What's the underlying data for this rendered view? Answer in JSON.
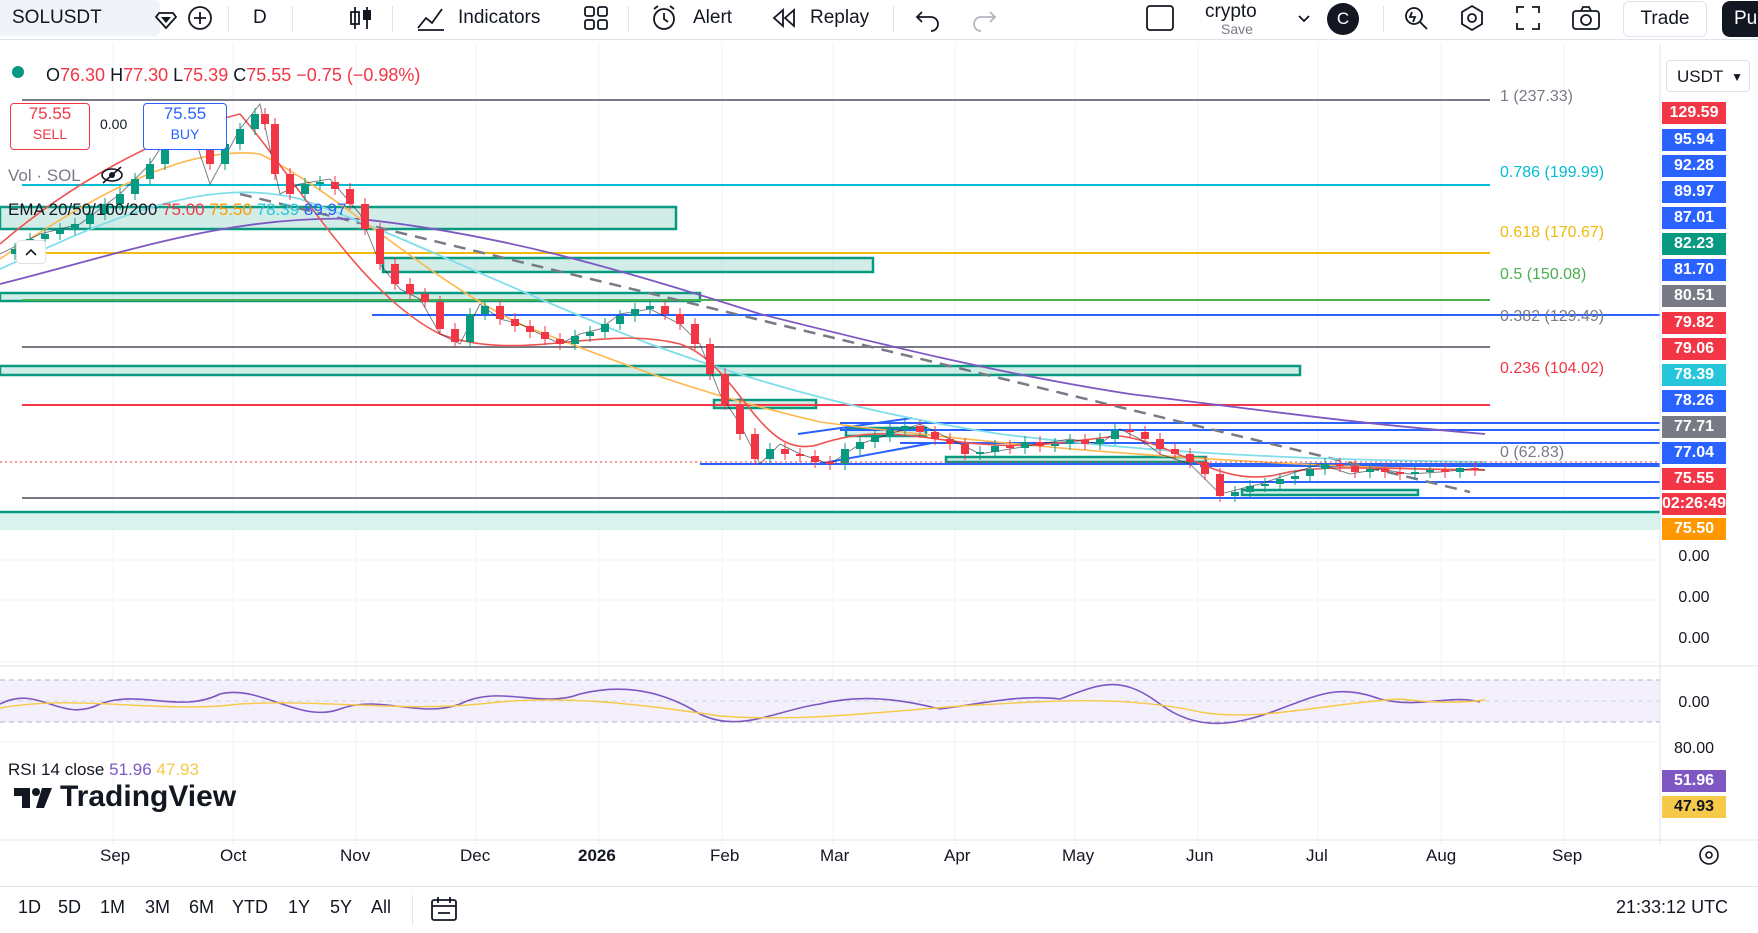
{
  "toolbar": {
    "symbol": "SOLUSDT",
    "interval": "D",
    "indicators_label": "Indicators",
    "alert_label": "Alert",
    "replay_label": "Replay",
    "layout_name": "crypto",
    "layout_sub": "Save",
    "avatar_letter": "C",
    "trade_label": "Trade",
    "publish_label": "Pu"
  },
  "legend": {
    "ohlc_o_label": "O",
    "ohlc_o": "76.30",
    "ohlc_h_label": "H",
    "ohlc_h": "77.30",
    "ohlc_l_label": "L",
    "ohlc_l": "75.39",
    "ohlc_c_label": "C",
    "ohlc_c": "75.55",
    "change": "−0.75 (−0.98%)",
    "sell_price": "75.55",
    "sell_label": "SELL",
    "spread": "0.00",
    "buy_price": "75.55",
    "buy_label": "BUY",
    "vol_label": "Vol · SOL",
    "ema_label": "EMA 20/50/100/200",
    "ema20": "75.00",
    "ema50": "75.50",
    "ema100": "78.39",
    "ema200": "89.97",
    "rsi_label": "RSI 14 close",
    "rsi_value": "51.96",
    "rsi_ma": "47.93"
  },
  "fib_levels": [
    {
      "label": "1 (237.33)",
      "color": "#787b86"
    },
    {
      "label": "0.786 (199.99)",
      "color": "#00bcd4"
    },
    {
      "label": "0.618 (170.67)",
      "color": "#f0b90b"
    },
    {
      "label": "0.5 (150.08)",
      "color": "#4caf50"
    },
    {
      "label": "0.382 (129.49)",
      "color": "#787b86"
    },
    {
      "label": "0.236 (104.02)",
      "color": "#f23645"
    },
    {
      "label": "0 (62.83)",
      "color": "#787b86"
    }
  ],
  "price_labels": [
    {
      "value": "129.59",
      "color": "#f23645"
    },
    {
      "value": "95.94",
      "color": "#2962ff"
    },
    {
      "value": "92.28",
      "color": "#2962ff"
    },
    {
      "value": "89.97",
      "color": "#2962ff"
    },
    {
      "value": "87.01",
      "color": "#2962ff"
    },
    {
      "value": "82.23",
      "color": "#089981"
    },
    {
      "value": "81.70",
      "color": "#2962ff"
    },
    {
      "value": "80.51",
      "color": "#787b86"
    },
    {
      "value": "79.82",
      "color": "#f23645"
    },
    {
      "value": "79.06",
      "color": "#f23645"
    },
    {
      "value": "78.39",
      "color": "#26c6da"
    },
    {
      "value": "78.26",
      "color": "#2962ff"
    },
    {
      "value": "77.71",
      "color": "#787b86"
    },
    {
      "value": "77.04",
      "color": "#2962ff"
    },
    {
      "value": "75.55",
      "color": "#f23645"
    },
    {
      "value": "02:26:49",
      "color": "#f23645"
    },
    {
      "value": "75.50",
      "color": "#ff9800"
    }
  ],
  "axis_plain": [
    "0.00",
    "0.00",
    "0.00",
    "0.00",
    "80.00"
  ],
  "rsi_labels": [
    {
      "value": "51.96",
      "color": "#7e57c2"
    },
    {
      "value": "47.93",
      "color": "#f7c948"
    }
  ],
  "currency": "USDT",
  "months": [
    "Sep",
    "Oct",
    "Nov",
    "Dec",
    "2026",
    "Feb",
    "Mar",
    "Apr",
    "May",
    "Jun",
    "Jul",
    "Aug",
    "Sep"
  ],
  "ranges": [
    "1D",
    "5D",
    "1M",
    "3M",
    "6M",
    "YTD",
    "1Y",
    "5Y",
    "All"
  ],
  "clock": "21:33:12 UTC",
  "brand": "TradingView",
  "colors": {
    "up": "#089981",
    "down": "#f23645",
    "accent": "#2962ff",
    "ema20": "#f23645",
    "ema50": "#ff9800",
    "ema100": "#26c6da",
    "ema200": "#2962ff"
  },
  "chart_data": {
    "type": "line",
    "title": "SOLUSDT",
    "series": [
      {
        "name": "EMA 20",
        "values": [
          75.0
        ]
      },
      {
        "name": "EMA 50",
        "values": [
          75.5
        ]
      },
      {
        "name": "EMA 100",
        "values": [
          78.39
        ]
      },
      {
        "name": "EMA 200",
        "values": [
          89.97
        ]
      }
    ],
    "x": [
      "Sep",
      "Oct",
      "Nov",
      "Dec",
      "2026",
      "Feb",
      "Mar",
      "Apr",
      "May",
      "Jun",
      "Jul",
      "Aug",
      "Sep"
    ],
    "close_approx": [
      210,
      225,
      200,
      135,
      130,
      110,
      85,
      80,
      82,
      78,
      65,
      80,
      76,
      75.55
    ]
  }
}
